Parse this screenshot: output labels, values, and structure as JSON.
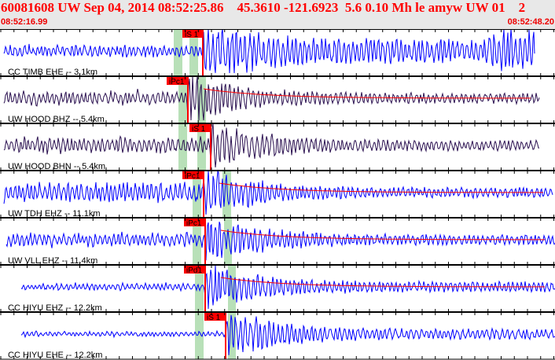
{
  "header": {
    "title": "60081608 UW Sep 04, 2014 08:52:25.86    45.3610 -121.6923  5.6 0.10 Mh le amyw UW 01    2",
    "start_time": "08:52:16.99",
    "end_time": "08:52:48.20"
  },
  "colors": {
    "pick": "#ff0000",
    "band": "#b8e0b8",
    "blue": "#0000ff",
    "purple": "#2a1050",
    "coda": "#ff0000"
  },
  "channels": [
    {
      "label": "CC TIMB EHE -- 3.1km",
      "pick": "iS 1",
      "color": "blue",
      "coda": false
    },
    {
      "label": "UW HOOD BHZ -- 5.4km",
      "pick": "iPc1",
      "color": "purple",
      "coda": true
    },
    {
      "label": "UW HOOD BHN -- 5.4km",
      "pick": "iS 1",
      "color": "purple",
      "coda": false
    },
    {
      "label": "UW TDH EHZ -- 11.1km",
      "pick": "iPc1",
      "color": "blue",
      "coda": true
    },
    {
      "label": "UW VLL EHZ -- 11.4km",
      "pick": "iPc1",
      "color": "blue",
      "coda": true
    },
    {
      "label": "CC HIYU EHZ -- 12.2km",
      "pick": "iPd1",
      "color": "blue",
      "coda": true
    },
    {
      "label": "CC HIYU EHE -- 12.2km",
      "pick": "iS 1",
      "color": "blue",
      "coda": false
    }
  ]
}
